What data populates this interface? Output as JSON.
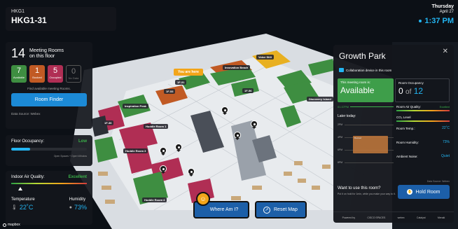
{
  "header": {
    "floor_code": "HKG1",
    "room_code": "HKG1-31",
    "day": "Thursday",
    "date": "April 27",
    "time": "1:37 PM"
  },
  "map": {
    "labels": [
      {
        "text": "Voice Still",
        "style": "dark"
      },
      {
        "text": "Innovation Beach",
        "style": "dark"
      },
      {
        "text": "You are here",
        "style": "you"
      },
      {
        "text": "1F-51",
        "style": "dark"
      },
      {
        "text": "1F-53",
        "style": "dark"
      },
      {
        "text": "1F-56",
        "style": "dark"
      },
      {
        "text": "Inspiration Peak",
        "style": "dark"
      },
      {
        "text": "Discovery Island",
        "style": "dark"
      },
      {
        "text": "1F-36",
        "style": "dark"
      },
      {
        "text": "Huddle Room 1",
        "style": "dark"
      },
      {
        "text": "Huddle Room 3",
        "style": "dark"
      },
      {
        "text": "Huddle Room 4",
        "style": "dark"
      }
    ],
    "attribution": "mapbox"
  },
  "rooms_summary": {
    "count": "14",
    "label_line1": "Meeting Rooms",
    "label_line2": "on this floor",
    "statuses": [
      {
        "count": "7",
        "label": "Available",
        "color": "#3e8e41"
      },
      {
        "count": "1",
        "label": "Booked",
        "color": "#c15a24"
      },
      {
        "count": "5",
        "label": "Occupied",
        "color": "#b02e54"
      },
      {
        "count": "0",
        "label": "No Data",
        "color": "#555555"
      }
    ],
    "find_text": "Find available meeting Rooms.",
    "room_finder_label": "Room Finder",
    "data_source": "Data Source: Webex"
  },
  "floor_occupancy": {
    "label": "Floor Occupancy:",
    "value": "Low",
    "level": 0.25,
    "note": "Open Spaces + Open Window"
  },
  "air_quality": {
    "label": "Indoor Air Quality:",
    "value": "Excellent",
    "temperature_label": "Temperature",
    "temperature_value": "22˚C",
    "humidity_label": "Humidity",
    "humidity_value": "73%"
  },
  "actions": {
    "where_am_i": "Where Am I?",
    "reset_map": "Reset Map"
  },
  "room_panel": {
    "title": "Growth Park",
    "collab_text": "Collaboration device in this room",
    "status_label": "This meeting room is:",
    "status_value": "Available",
    "occupancy_label": "Room Occupancy",
    "occupancy_current": "0",
    "occupancy_of": "of",
    "occupancy_capacity": "12",
    "now_label": "01:37PM",
    "later_label": "Later today:",
    "schedule_times": [
      "2PM",
      "4PM",
      "6PM",
      "8PM"
    ],
    "booking_text": "Booked",
    "metrics": {
      "air_label": "Room Air Quality:",
      "air_value": "Excellent",
      "co2_label": "CO₂ Level",
      "temp_label": "Room Temp.:",
      "temp_value": "22˚C",
      "humidity_label": "Room Humidity:",
      "humidity_value": "73%",
      "noise_label": "Ambient Noise:",
      "noise_value": "Quiet"
    },
    "data_source": "Data Source: Webex",
    "use_title": "Want to use this room?",
    "use_desc": "Put it on hold for 1min, while you make your way to it.",
    "hold_label": "Hold Room",
    "partners": [
      "Powered by",
      "CISCO SPACES",
      "webex",
      "Catalyst",
      "Meraki"
    ]
  }
}
